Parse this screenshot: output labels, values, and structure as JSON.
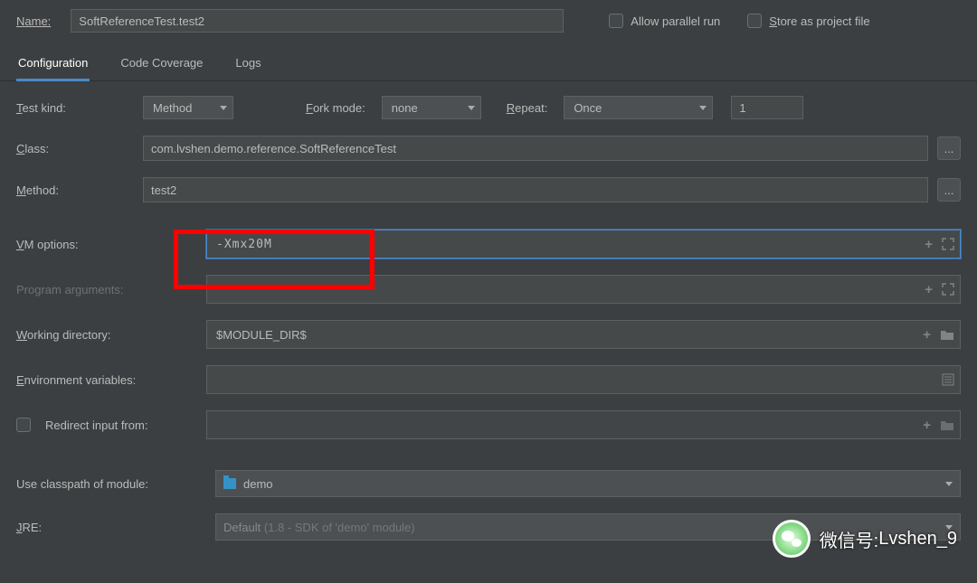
{
  "header": {
    "name_label": "Name:",
    "name_value": "SoftReferenceTest.test2",
    "allow_parallel": "Allow parallel run",
    "store_project": "Store as project file"
  },
  "tabs": {
    "configuration": "Configuration",
    "code_coverage": "Code Coverage",
    "logs": "Logs"
  },
  "form": {
    "test_kind_label": "Test kind:",
    "test_kind_value": "Method",
    "fork_mode_label": "Fork mode:",
    "fork_mode_value": "none",
    "repeat_label": "Repeat:",
    "repeat_value": "Once",
    "repeat_count": "1",
    "class_label": "Class:",
    "class_value": "com.lvshen.demo.reference.SoftReferenceTest",
    "method_label": "Method:",
    "method_value": "test2",
    "vm_options_label": "VM options:",
    "vm_options_value": "-Xmx20M",
    "program_args_label": "Program arguments:",
    "working_dir_label": "Working directory:",
    "working_dir_value": "$MODULE_DIR$",
    "env_vars_label": "Environment variables:",
    "redirect_label": "Redirect input from:",
    "use_classpath_label": "Use classpath of module:",
    "use_classpath_value": "demo",
    "jre_label": "JRE:",
    "jre_value_prefix": "Default ",
    "jre_value_suffix": "(1.8 - SDK of 'demo' module)",
    "ellipsis": "..."
  },
  "watermark": {
    "label": "微信号: ",
    "value": "Lvshen_9"
  }
}
